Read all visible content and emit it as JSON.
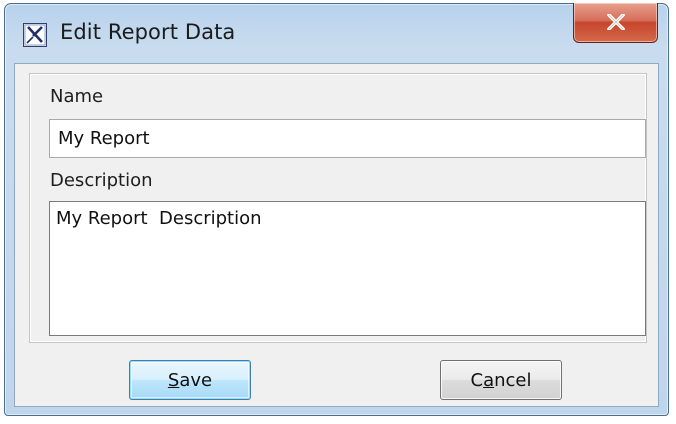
{
  "window": {
    "title": "Edit Report Data",
    "app_icon": "magicdraw-app-icon",
    "close_icon": "close-x-icon"
  },
  "form": {
    "name_label": "Name",
    "name_value": "My Report",
    "description_label": "Description",
    "description_value": "My Report  Description"
  },
  "buttons": {
    "save": {
      "mnemonic": "S",
      "rest": "ave"
    },
    "cancel": {
      "before": "C",
      "mnemonic": "a",
      "after": "ncel"
    }
  },
  "colors": {
    "title_bar": "#c4dbf0",
    "close_button": "#c7452b",
    "dialog_body": "#f0f0f0",
    "default_button_border": "#3c7fb1"
  }
}
